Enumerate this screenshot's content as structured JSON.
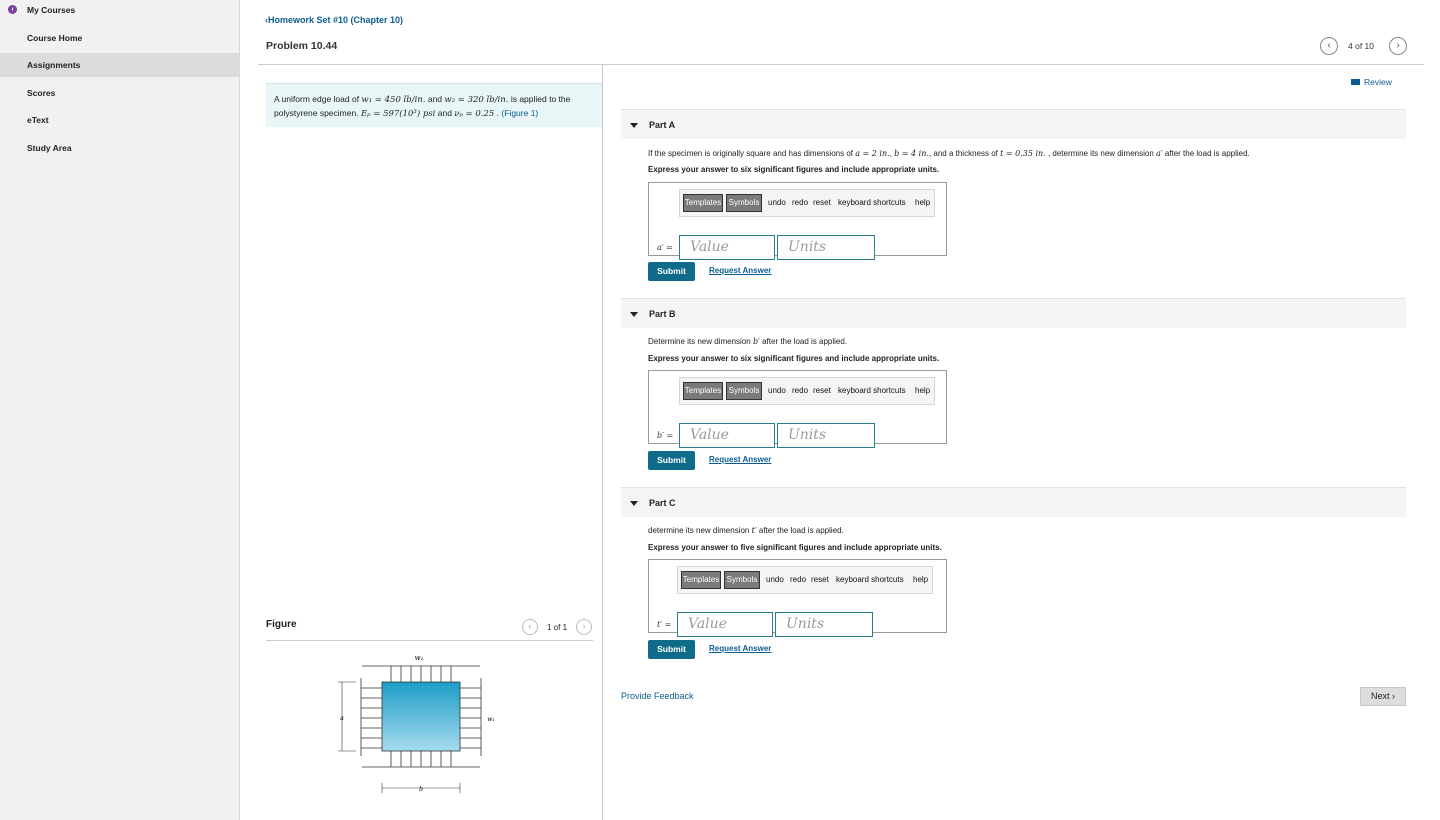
{
  "sidebar": {
    "items": [
      {
        "label": "My Courses"
      },
      {
        "label": "Course Home"
      },
      {
        "label": "Assignments"
      },
      {
        "label": "Scores"
      },
      {
        "label": "eText"
      },
      {
        "label": "Study Area"
      }
    ]
  },
  "header": {
    "back_link": "Homework Set #10 (Chapter 10)",
    "title": "Problem 10.44",
    "pager_text": "4 of 10"
  },
  "problem": {
    "intro": "A uniform edge load of ",
    "w1": "w₁ = 450 lb/in.",
    "and1": " and ",
    "w2": "w₂ = 320 lb/in.",
    "applied": " is applied to the polystyrene specimen. ",
    "Ep": "Eₚ = 597(10³) psi",
    "and2": " and ",
    "nu": "νₚ = 0.25",
    "period": " . ",
    "figure_link": "(Figure 1)"
  },
  "figure": {
    "title": "Figure",
    "pager_text": "1 of 1",
    "labels": {
      "top": "w₂",
      "right": "w₁",
      "left": "a",
      "bottom": "b"
    }
  },
  "review_label": "Review",
  "toolbar": {
    "templates": "Templates",
    "symbols": "Symbols",
    "undo": "undo",
    "redo": "redo",
    "reset": "reset",
    "shortcuts": "keyboard shortcuts",
    "help": "help"
  },
  "inputs": {
    "value_placeholder": "Value",
    "units_placeholder": "Units"
  },
  "parts": [
    {
      "title": "Part A",
      "q_pre": "If the specimen is originally square and has dimensions of ",
      "q_a": "a = 2 in.",
      "q_mid1": ", ",
      "q_b": "b = 4 in.",
      "q_mid2": ", and a thickness of ",
      "q_t": "t = 0.35 in.",
      "q_mid3": " , determine its new dimension ",
      "q_var": "a′",
      "q_post": " after the load is applied.",
      "instruction": "Express your answer to six significant figures and include appropriate units.",
      "label": "a′ =",
      "submit": "Submit",
      "request": "Request Answer"
    },
    {
      "title": "Part B",
      "q_pre": "Determine its new dimension ",
      "q_var": "b′",
      "q_post": " after the load is applied.",
      "instruction": "Express your answer to six significant figures and include appropriate units.",
      "label": "b′ =",
      "submit": "Submit",
      "request": "Request Answer"
    },
    {
      "title": "Part C",
      "q_pre": "determine its new dimension ",
      "q_var": "t′",
      "q_post": " after the load is applied.",
      "instruction": "Express your answer to five significant figures and include appropriate units.",
      "label": "t′ =",
      "submit": "Submit",
      "request": "Request Answer"
    }
  ],
  "footer": {
    "feedback": "Provide Feedback",
    "next": "Next"
  },
  "colors": {
    "accent": "#0e6b8a",
    "link": "#0b5d91",
    "specimen": "#3aaed0"
  }
}
